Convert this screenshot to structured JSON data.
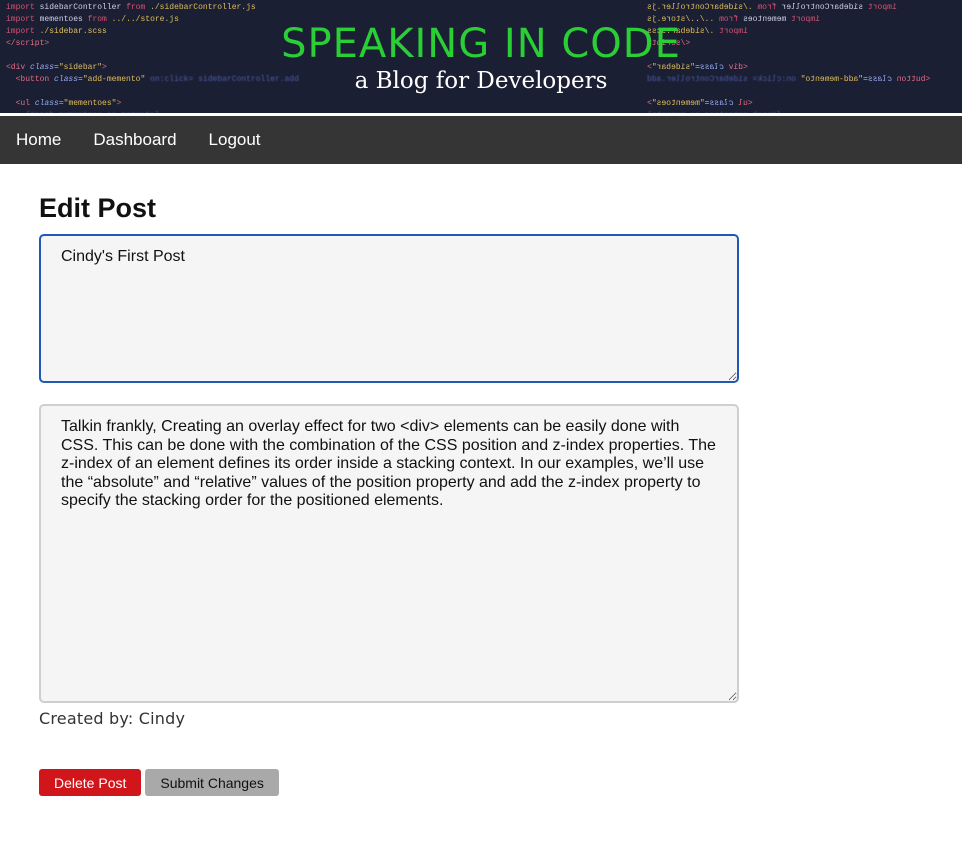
{
  "banner": {
    "title": "SPEAKING IN CODE",
    "subtitle": "a Blog for Developers"
  },
  "nav": {
    "items": [
      {
        "label": "Home"
      },
      {
        "label": "Dashboard"
      },
      {
        "label": "Logout"
      }
    ]
  },
  "edit": {
    "heading": "Edit Post",
    "post_title": "Cindy's First Post",
    "post_content": "Talkin frankly, Creating an overlay effect for two <div> elements can be easily done with CSS. This can be done with the combination of the CSS position and z-index properties. The z-index of an element defines its order inside a stacking context. In our examples, we’ll use the “absolute” and “relative” values of the position property and add the z-index property to specify the stacking order for the positioned elements.",
    "created_by": "Created by: Cindy"
  },
  "actions": {
    "delete_label": "Delete Post",
    "submit_label": "Submit Changes"
  },
  "colors": {
    "banner_title": "#29cf35",
    "navbar_bg": "#353535",
    "delete_button": "#d0161b",
    "submit_button": "#a9a9a9",
    "focus_border": "#1f58b5"
  }
}
